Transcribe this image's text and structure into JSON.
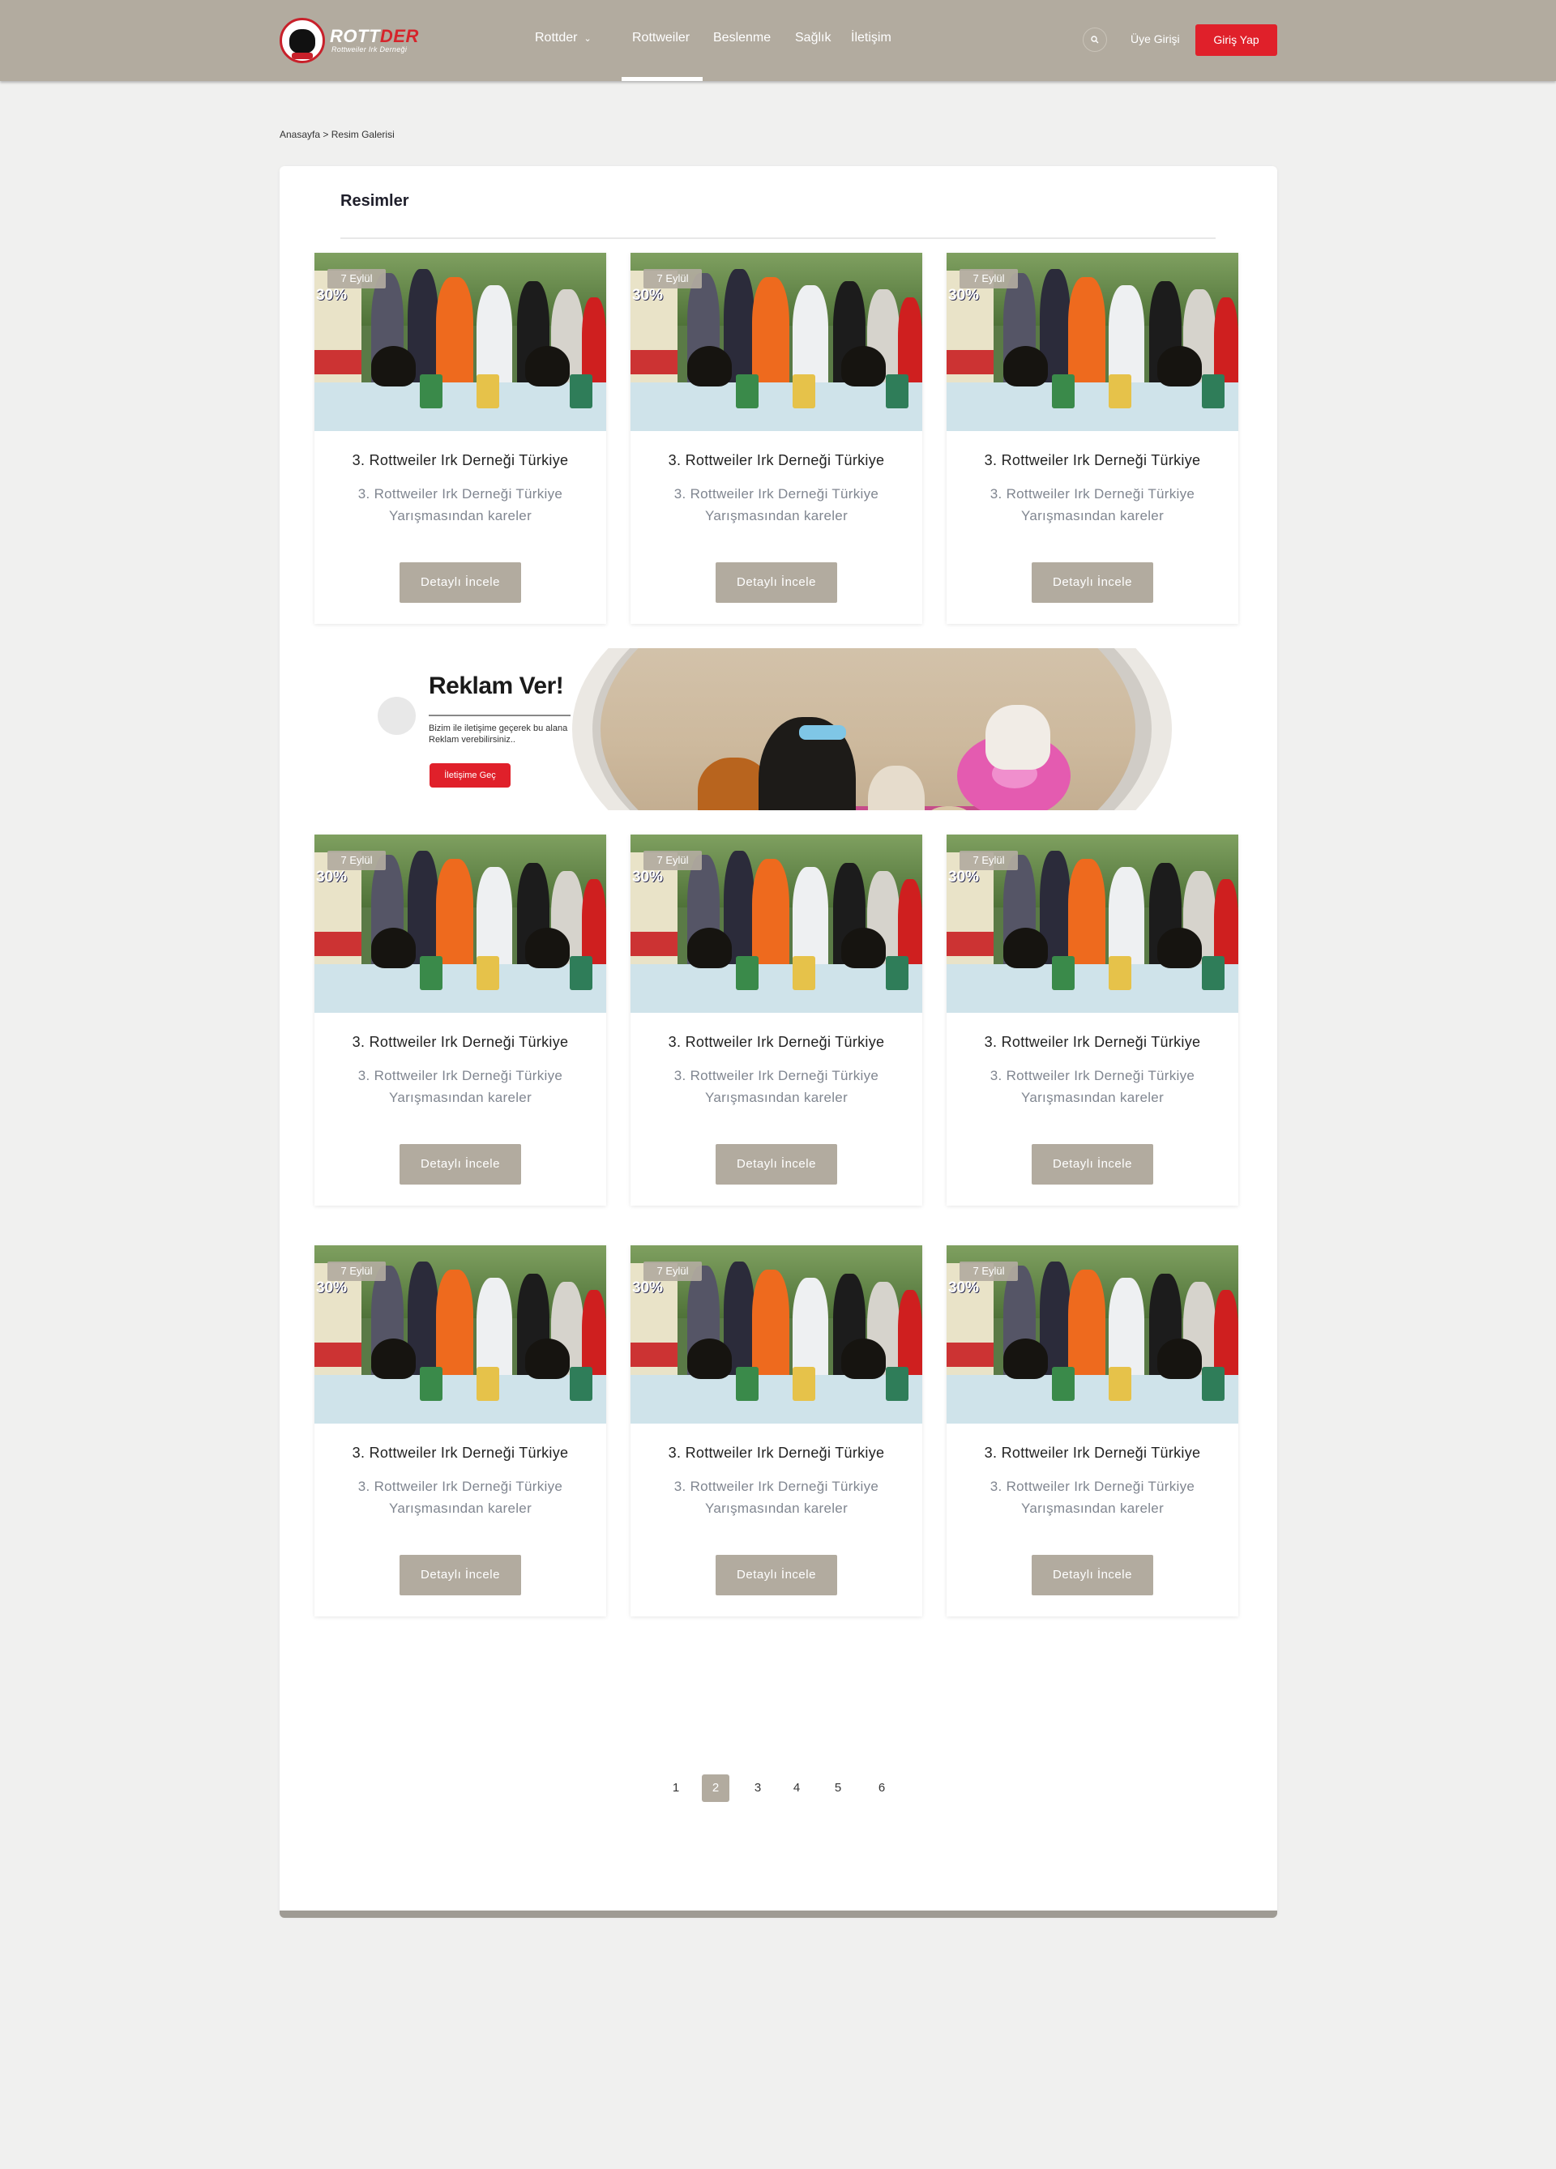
{
  "header": {
    "logo": {
      "brand_white": "ROTT",
      "brand_red": "DER",
      "subtitle": "Rottweiler Irk Derneği"
    },
    "nav": [
      {
        "label": "Rottder",
        "has_dropdown": true,
        "active": false
      },
      {
        "label": "Rottweiler",
        "has_dropdown": false,
        "active": true
      },
      {
        "label": "Beslenme",
        "has_dropdown": false,
        "active": false
      },
      {
        "label": "Sağlık",
        "has_dropdown": false,
        "active": false
      },
      {
        "label": "İletişim",
        "has_dropdown": false,
        "active": false
      }
    ],
    "search_icon": "search-icon",
    "login_label": "Üye Girişi",
    "signup_label": "Giriş Yap"
  },
  "breadcrumb": {
    "home": "Anasayfa",
    "separator": ">",
    "current": "Resim Galerisi"
  },
  "main": {
    "section_title": "Resimler",
    "items": [
      {
        "date": "7 Eylül",
        "title": "3. Rottweiler Irk Derneği Türkiye",
        "description": "3. Rottweiler Irk Derneği Türkiye Yarışmasından kareler",
        "button": "Detaylı İncele"
      },
      {
        "date": "7 Eylül",
        "title": "3. Rottweiler Irk Derneği Türkiye",
        "description": "3. Rottweiler Irk Derneği Türkiye Yarışmasından kareler",
        "button": "Detaylı İncele"
      },
      {
        "date": "7 Eylül",
        "title": "3. Rottweiler Irk Derneği Türkiye",
        "description": "3. Rottweiler Irk Derneği Türkiye Yarışmasından kareler",
        "button": "Detaylı İncele"
      },
      {
        "date": "7 Eylül",
        "title": "3. Rottweiler Irk Derneği Türkiye",
        "description": "3. Rottweiler Irk Derneği Türkiye Yarışmasından kareler",
        "button": "Detaylı İncele"
      },
      {
        "date": "7 Eylül",
        "title": "3. Rottweiler Irk Derneği Türkiye",
        "description": "3. Rottweiler Irk Derneği Türkiye Yarışmasından kareler",
        "button": "Detaylı İncele"
      },
      {
        "date": "7 Eylül",
        "title": "3. Rottweiler Irk Derneği Türkiye",
        "description": "3. Rottweiler Irk Derneği Türkiye Yarışmasından kareler",
        "button": "Detaylı İncele"
      },
      {
        "date": "7 Eylül",
        "title": "3. Rottweiler Irk Derneği Türkiye",
        "description": "3. Rottweiler Irk Derneği Türkiye Yarışmasından kareler",
        "button": "Detaylı İncele"
      },
      {
        "date": "7 Eylül",
        "title": "3. Rottweiler Irk Derneği Türkiye",
        "description": "3. Rottweiler Irk Derneği Türkiye Yarışmasından kareler",
        "button": "Detaylı İncele"
      },
      {
        "date": "7 Eylül",
        "title": "3. Rottweiler Irk Derneği Türkiye",
        "description": "3. Rottweiler Irk Derneği Türkiye Yarışmasından kareler",
        "button": "Detaylı İncele"
      }
    ],
    "photo_overlay_text": "30%",
    "ad": {
      "title": "Reklam Ver!",
      "text": "Bizim ile iletişime geçerek bu alana Reklam verebilirsiniz..",
      "button": "İletişime Geç"
    },
    "pagination": {
      "pages": [
        "1",
        "2",
        "3",
        "4",
        "5",
        "6"
      ],
      "current": "2"
    }
  },
  "colors": {
    "header_bg": "#b2ab9f",
    "accent_red": "#e0202a",
    "button_bg": "#b2ab9f",
    "page_bg": "#f0f0ef"
  }
}
